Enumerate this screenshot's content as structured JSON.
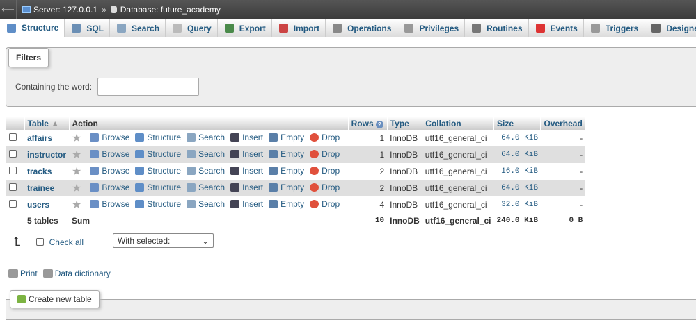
{
  "breadcrumb": {
    "server": "Server: 127.0.0.1",
    "separator": "»",
    "database": "Database: future_academy"
  },
  "tabs": [
    {
      "label": "Structure",
      "icon": "structure-icon",
      "color": "#5f8ec7"
    },
    {
      "label": "SQL",
      "icon": "sql-icon",
      "color": "#6b8fb5"
    },
    {
      "label": "Search",
      "icon": "search-icon",
      "color": "#8aa6c1"
    },
    {
      "label": "Query",
      "icon": "query-icon",
      "color": "#bbb"
    },
    {
      "label": "Export",
      "icon": "export-icon",
      "color": "#4a8a4a"
    },
    {
      "label": "Import",
      "icon": "import-icon",
      "color": "#c44"
    },
    {
      "label": "Operations",
      "icon": "wrench-icon",
      "color": "#888"
    },
    {
      "label": "Privileges",
      "icon": "privileges-icon",
      "color": "#999"
    },
    {
      "label": "Routines",
      "icon": "routines-icon",
      "color": "#777"
    },
    {
      "label": "Events",
      "icon": "clock-icon",
      "color": "#d33"
    },
    {
      "label": "Triggers",
      "icon": "triggers-icon",
      "color": "#999"
    },
    {
      "label": "Designer",
      "icon": "designer-icon",
      "color": "#666"
    }
  ],
  "filters": {
    "legend": "Filters",
    "label": "Containing the word:",
    "value": ""
  },
  "table": {
    "headers": {
      "table": "Table",
      "action": "Action",
      "rows": "Rows",
      "type": "Type",
      "collation": "Collation",
      "size": "Size",
      "overhead": "Overhead"
    },
    "actions": {
      "browse": "Browse",
      "structure": "Structure",
      "search": "Search",
      "insert": "Insert",
      "empty": "Empty",
      "drop": "Drop"
    },
    "rows": [
      {
        "name": "affairs",
        "rows": "1",
        "type": "InnoDB",
        "collation": "utf16_general_ci",
        "size": "64.0 KiB",
        "overhead": "-"
      },
      {
        "name": "instructor",
        "rows": "1",
        "type": "InnoDB",
        "collation": "utf16_general_ci",
        "size": "64.0 KiB",
        "overhead": "-"
      },
      {
        "name": "tracks",
        "rows": "2",
        "type": "InnoDB",
        "collation": "utf16_general_ci",
        "size": "16.0 KiB",
        "overhead": "-"
      },
      {
        "name": "trainee",
        "rows": "2",
        "type": "InnoDB",
        "collation": "utf16_general_ci",
        "size": "64.0 KiB",
        "overhead": "-"
      },
      {
        "name": "users",
        "rows": "4",
        "type": "InnoDB",
        "collation": "utf16_general_ci",
        "size": "32.0 KiB",
        "overhead": "-"
      }
    ],
    "summary": {
      "count": "5 tables",
      "label": "Sum",
      "rows": "10",
      "type": "InnoDB",
      "collation": "utf16_general_ci",
      "size": "240.0 KiB",
      "overhead": "0 B"
    }
  },
  "bulk": {
    "check_all": "Check all",
    "with_selected": "With selected:"
  },
  "footer": {
    "print": "Print",
    "data_dictionary": "Data dictionary",
    "create_table": "Create new table"
  }
}
